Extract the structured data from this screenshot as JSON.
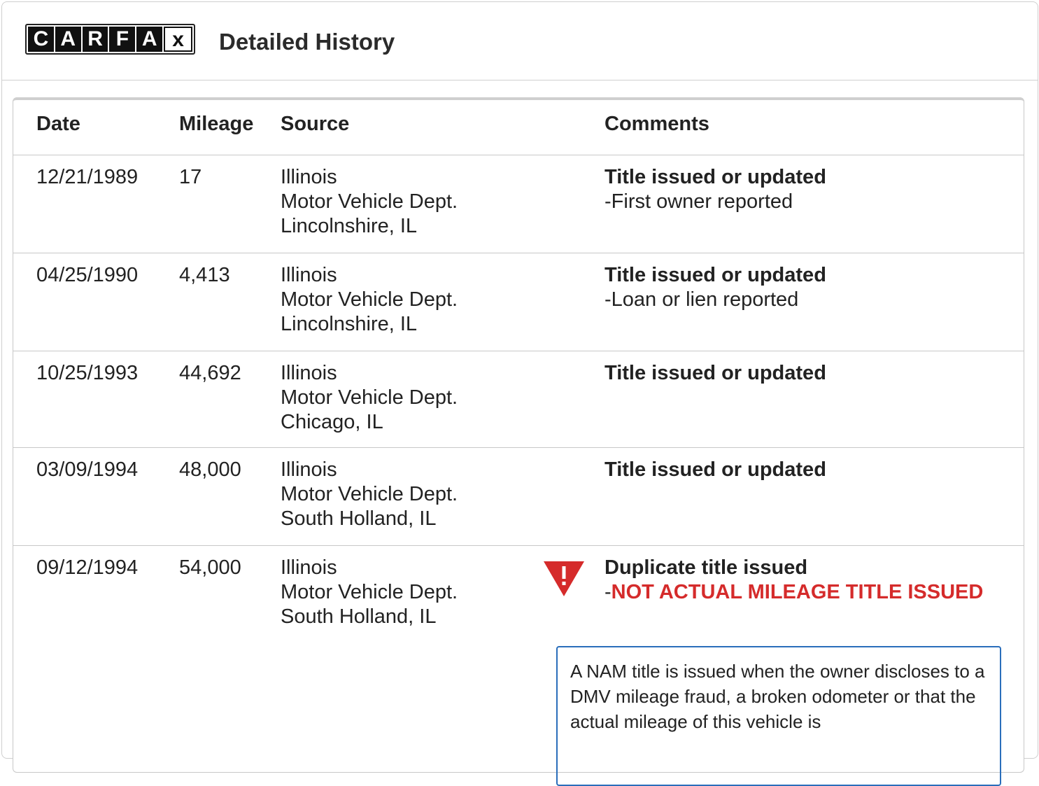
{
  "header": {
    "logo_letters": [
      "C",
      "A",
      "R",
      "F",
      "A",
      "x"
    ],
    "title": "Detailed History"
  },
  "table": {
    "columns": [
      "Date",
      "Mileage",
      "Source",
      "Comments"
    ],
    "rows": [
      {
        "date": "12/21/1989",
        "mileage": "17",
        "source": [
          "Illinois",
          "Motor Vehicle Dept.",
          "Lincolnshire, IL"
        ],
        "comment_title": "Title issued or updated",
        "comment_detail": "First owner reported"
      },
      {
        "date": "04/25/1990",
        "mileage": "4,413",
        "source": [
          "Illinois",
          "Motor Vehicle Dept.",
          "Lincolnshire, IL"
        ],
        "comment_title": "Title issued or updated",
        "comment_detail": "Loan or lien reported"
      },
      {
        "date": "10/25/1993",
        "mileage": "44,692",
        "source": [
          "Illinois",
          "Motor Vehicle Dept.",
          "Chicago, IL"
        ],
        "comment_title": "Title issued or updated"
      },
      {
        "date": "03/09/1994",
        "mileage": "48,000",
        "source": [
          "Illinois",
          "Motor Vehicle Dept.",
          "South Holland, IL"
        ],
        "comment_title": "Title issued or updated"
      },
      {
        "date": "09/12/1994",
        "mileage": "54,000",
        "source": [
          "Illinois",
          "Motor Vehicle Dept.",
          "South Holland, IL"
        ],
        "comment_title": "Duplicate title issued",
        "comment_alert": "NOT ACTUAL MILEAGE TITLE ISSUED",
        "note": "A NAM title is issued when the owner discloses to a DMV mileage fraud, a broken odometer or that the actual mileage of this vehicle is"
      }
    ]
  },
  "colors": {
    "alert": "#d52b2b",
    "note_border": "#2a6ebb",
    "warning_icon": "#d52b2b"
  },
  "icons": {
    "warning": "warning-triangle-icon"
  }
}
